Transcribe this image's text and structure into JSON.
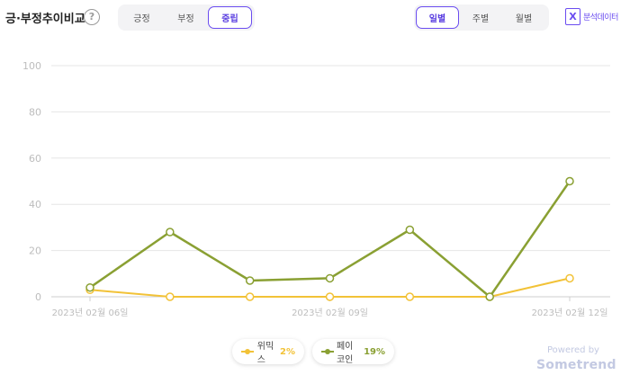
{
  "header": {
    "title": "긍·부정추이비교",
    "help_symbol": "?",
    "sentiment_tabs": [
      "긍정",
      "부정",
      "중립"
    ],
    "sentiment_active": "중립",
    "period_tabs": [
      "일별",
      "주별",
      "월별"
    ],
    "period_active": "일별",
    "excel_label": "분석데이터",
    "excel_icon": "excel-icon"
  },
  "chart_data": {
    "type": "line",
    "x": [
      "2023-02-06",
      "2023-02-07",
      "2023-02-08",
      "2023-02-09",
      "2023-02-10",
      "2023-02-11",
      "2023-02-12"
    ],
    "x_tick_labels": [
      "2023년 02월 06일",
      "2023년 02월 09일",
      "2023년 02월 12일"
    ],
    "y_ticks": [
      0,
      20,
      40,
      60,
      80,
      100
    ],
    "ylim": [
      0,
      100
    ],
    "grid": true,
    "series": [
      {
        "name": "위믹스",
        "share": "2%",
        "color": "#f2c237",
        "values": [
          3,
          0,
          0,
          0,
          0,
          0,
          8
        ]
      },
      {
        "name": "페이코인",
        "share": "19%",
        "color": "#8aa033",
        "values": [
          4,
          28,
          7,
          8,
          29,
          0,
          50
        ]
      }
    ],
    "legend_position": "bottom-center"
  },
  "footer": {
    "powered_by": "Powered by",
    "brand": "Sometrend"
  }
}
